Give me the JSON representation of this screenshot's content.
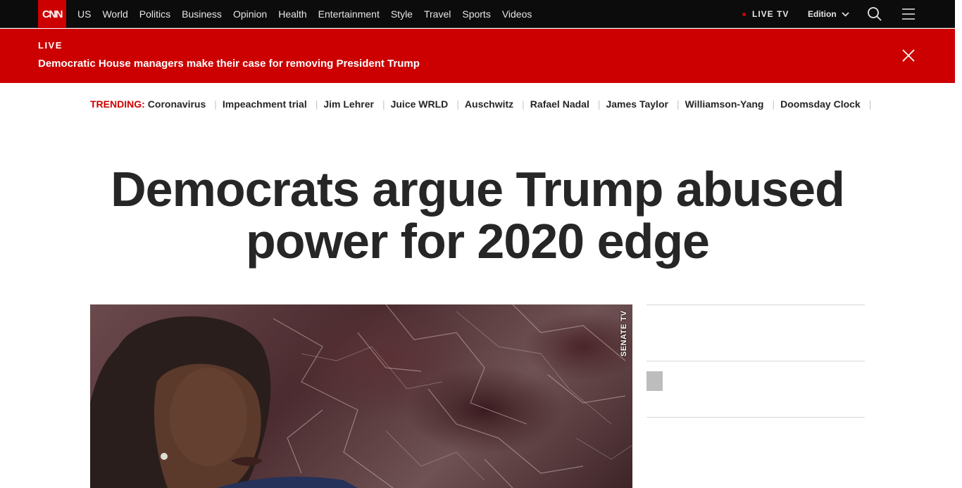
{
  "nav": {
    "logo": "CNN",
    "links": [
      "US",
      "World",
      "Politics",
      "Business",
      "Opinion",
      "Health",
      "Entertainment",
      "Style",
      "Travel",
      "Sports",
      "Videos"
    ],
    "live_tv": "LIVE TV",
    "edition": "Edition",
    "icons": [
      "search-icon",
      "menu-icon",
      "chevron-down-icon"
    ]
  },
  "banner": {
    "label": "LIVE",
    "headline": "Democratic House managers make their case for removing President Trump",
    "icon": "close-icon"
  },
  "trending": {
    "label": "TRENDING:",
    "items": [
      "Coronavirus",
      "Impeachment trial",
      "Jim Lehrer",
      "Juice WRLD",
      "Auschwitz",
      "Rafael Nadal",
      "James Taylor",
      "Williamson-Yang",
      "Doomsday Clock"
    ]
  },
  "article": {
    "headline": "Democrats argue Trump abused power for 2020 edge",
    "image_watermark": "SENATE TV"
  },
  "colors": {
    "brand_red": "#cc0000",
    "nav_bg": "#0c0c0c",
    "text": "#262626"
  }
}
